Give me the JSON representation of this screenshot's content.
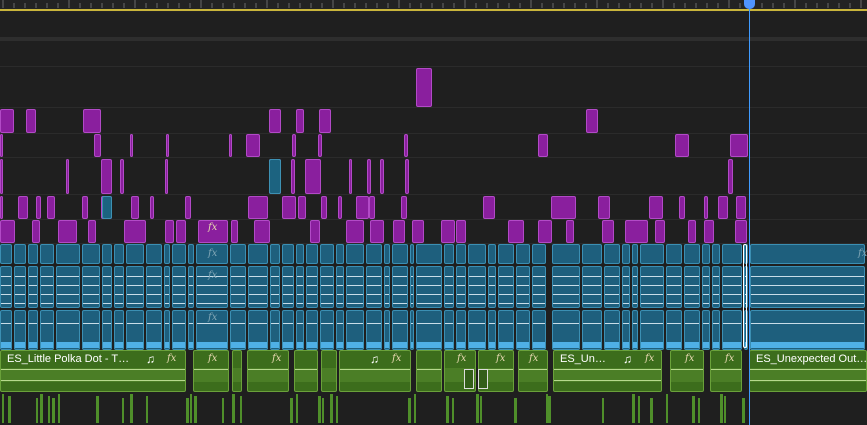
{
  "app": {
    "panel": "timeline"
  },
  "colors": {
    "video_clip": "#8a1f9e",
    "audio_clip": "#1e5f7d",
    "waveform": "#4fb0e6",
    "music_clip": "#3c6d1c",
    "playhead": "#3f9bff",
    "work_area_bar": "#c9b53b"
  },
  "icons": {
    "effect": "fx-badge-icon",
    "music": "music-note-icon",
    "playhead": "playhead-handle-icon"
  },
  "fx_label": "fx",
  "note_label": "♫",
  "music_clips": {
    "first": {
      "name": "ES_Little Polka Dot - The ..."
    },
    "second": {
      "name": "ES_Une..."
    },
    "third": {
      "name": "ES_Unexpected Outcome"
    }
  }
}
